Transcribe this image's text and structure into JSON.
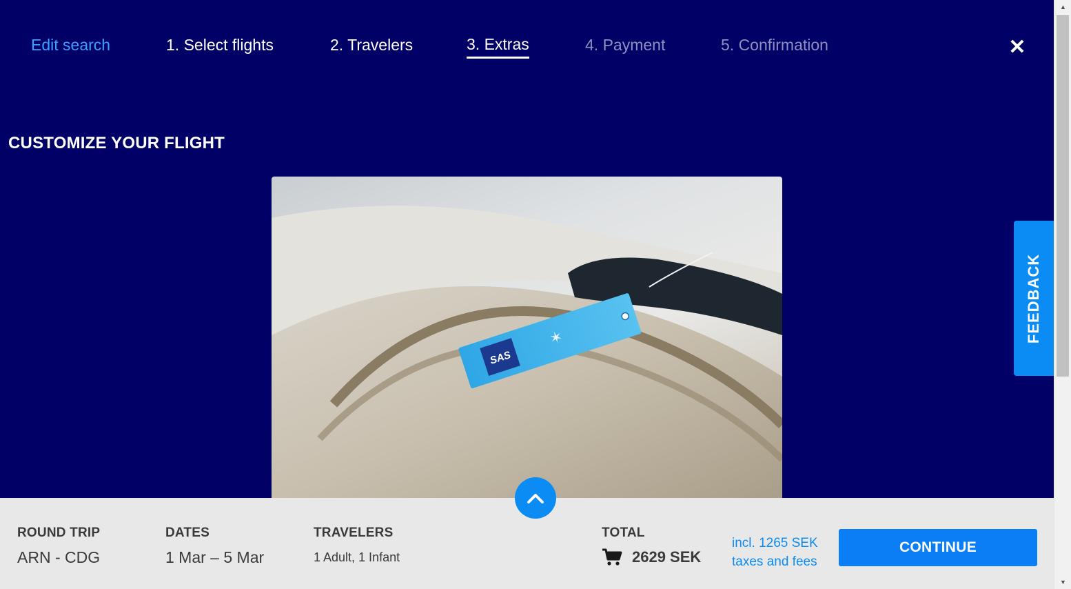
{
  "steps": {
    "edit_search": "Edit search",
    "select_flights": "1. Select flights",
    "travelers": "2. Travelers",
    "extras": "3. Extras",
    "payment": "4. Payment",
    "confirmation": "5. Confirmation"
  },
  "close_icon": "close-icon",
  "page_title": "CUSTOMIZE YOUR FLIGHT",
  "hero_tag_logo": "SAS",
  "feedback_label": "FEEDBACK",
  "summary": {
    "trip_label": "ROUND TRIP",
    "route": "ARN - CDG",
    "dates_label": "DATES",
    "dates": "1 Mar – 5 Mar",
    "travelers_label": "TRAVELERS",
    "travelers": "1 Adult, 1 Infant",
    "total_label": "TOTAL",
    "total": "2629 SEK",
    "taxes_line1": "incl. 1265 SEK",
    "taxes_line2": "taxes and fees",
    "continue_label": "CONTINUE"
  },
  "colors": {
    "background": "#000066",
    "accent": "#0b8cf5",
    "summary_bg": "#e8e8e8"
  }
}
